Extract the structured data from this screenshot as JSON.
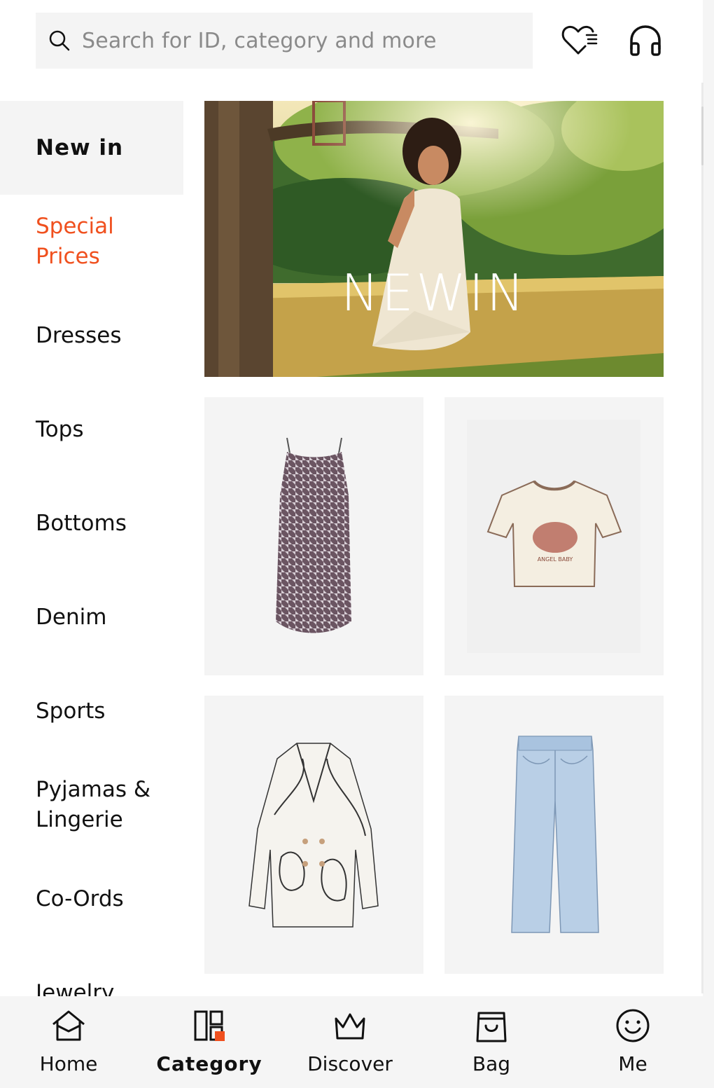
{
  "search": {
    "placeholder": "Search for ID, category and more",
    "icon": "search-icon"
  },
  "header_icons": [
    {
      "name": "wishlist-icon"
    },
    {
      "name": "headphones-icon"
    }
  ],
  "sidebar": {
    "items": [
      {
        "label": "New in",
        "active": true
      },
      {
        "label": "Special\nPrices",
        "highlight_color": "#f0501e"
      },
      {
        "label": "Dresses"
      },
      {
        "label": "Tops"
      },
      {
        "label": "Bottoms"
      },
      {
        "label": "Denim"
      },
      {
        "label": "Sports"
      },
      {
        "label": "Pyjamas &\nLingerie"
      },
      {
        "label": "Co-Ords"
      },
      {
        "label": "Jewelry"
      }
    ]
  },
  "banner": {
    "title": "NEWIN"
  },
  "products": [
    {
      "name": "dress-thumbnail"
    },
    {
      "name": "tshirt-thumbnail",
      "print_text": "ANGEL BABY"
    },
    {
      "name": "blazer-thumbnail"
    },
    {
      "name": "jeans-thumbnail"
    }
  ],
  "bottom_nav": [
    {
      "label": "Home",
      "icon": "home-icon"
    },
    {
      "label": "Category",
      "icon": "category-icon",
      "active": true
    },
    {
      "label": "Discover",
      "icon": "crown-icon"
    },
    {
      "label": "Bag",
      "icon": "bag-icon"
    },
    {
      "label": "Me",
      "icon": "smiley-icon"
    }
  ],
  "colors": {
    "accent": "#f0501e",
    "panel": "#f4f4f4"
  }
}
